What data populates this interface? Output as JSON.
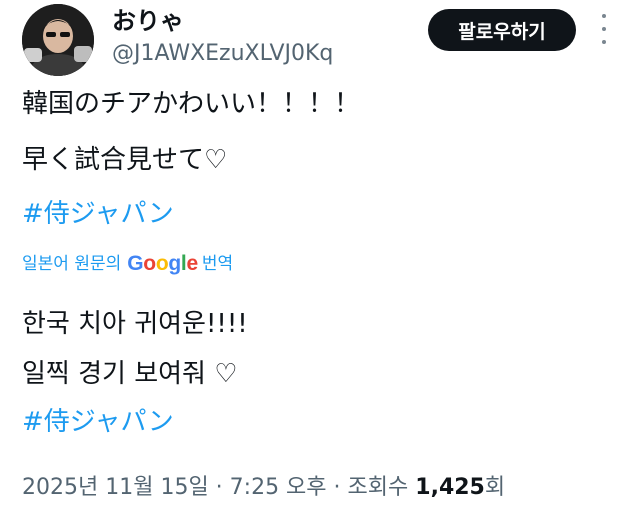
{
  "author": {
    "display_name": "おりゃ",
    "handle": "@J1AWXEzuXLVJ0Kq"
  },
  "follow_button_label": "팔로우하기",
  "more_icon": "more-vertical-icon",
  "tweet": {
    "original_lines": [
      "韓国のチアかわいい！！！！",
      "早く試合見せて♡"
    ],
    "original_hashtag": "#侍ジャパン",
    "translation_label_prefix": "일본어 원문의",
    "translation_label_suffix": "번역",
    "google_letters": [
      "G",
      "o",
      "o",
      "g",
      "l",
      "e"
    ],
    "translated_lines": [
      "한국 치아 귀여운!!!!",
      "일찍 경기 보여줘 ♡"
    ],
    "translated_hashtag": "#侍ジャパン"
  },
  "meta": {
    "timestamp": "2025년 11월 15일 · 7:25 오후",
    "separator": "·",
    "views_label": "조회수",
    "views_count": "1,425",
    "views_suffix": "회"
  },
  "colors": {
    "link": "#1d9bf0",
    "secondary_text": "#536471",
    "primary_text": "#0f1419",
    "follow_button_bg": "#0f1419",
    "google": [
      "#4285F4",
      "#EA4335",
      "#FBBC05",
      "#4285F4",
      "#34A853",
      "#EA4335"
    ]
  }
}
